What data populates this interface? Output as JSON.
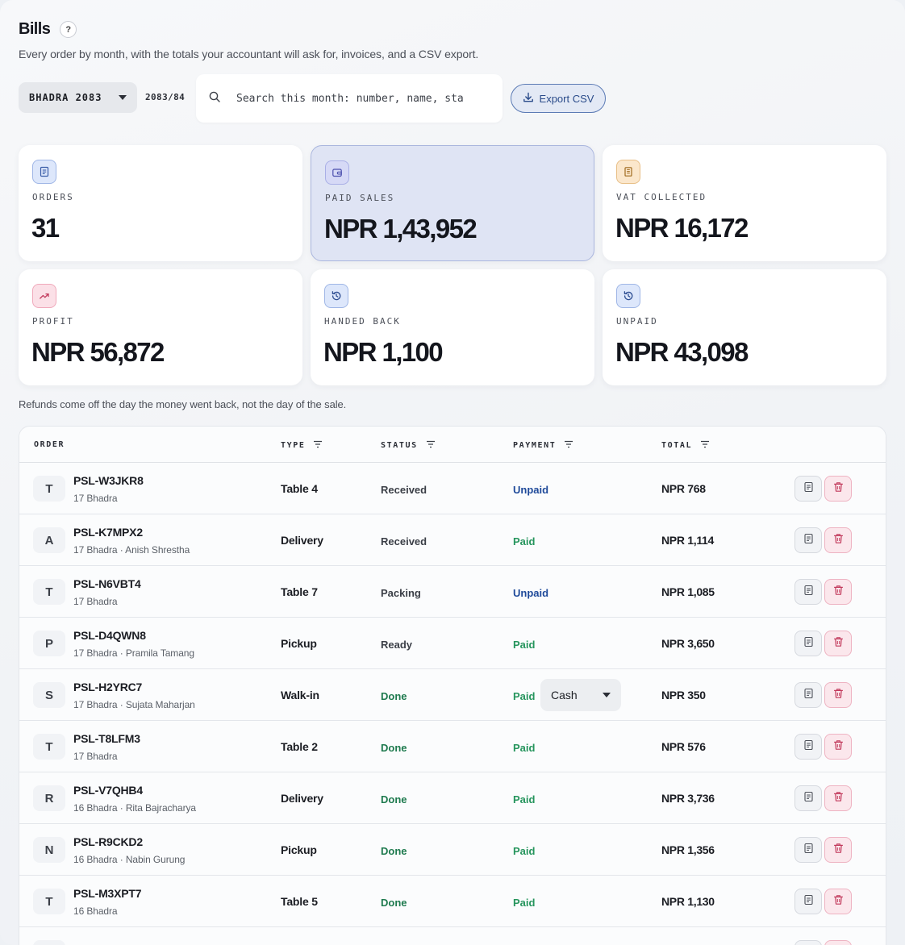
{
  "header": {
    "title": "Bills",
    "help_label": "?",
    "subtitle": "Every order by month, with the totals your accountant will ask for, invoices, and a CSV export."
  },
  "toolbar": {
    "month": "BHADRA 2083",
    "fiscal_year": "2083/84",
    "search_placeholder": "Search this month: number, name, sta",
    "export_label": "Export CSV"
  },
  "stats": [
    {
      "label": "ORDERS",
      "value": "31",
      "icon": "receipt-icon"
    },
    {
      "label": "PAID SALES",
      "value": "NPR 1,43,952",
      "icon": "wallet-icon"
    },
    {
      "label": "VAT COLLECTED",
      "value": "NPR 16,172",
      "icon": "building-icon"
    },
    {
      "label": "PROFIT",
      "value": "NPR 56,872",
      "icon": "trending-up-icon"
    },
    {
      "label": "HANDED BACK",
      "value": "NPR 1,100",
      "icon": "history-icon"
    },
    {
      "label": "UNPAID",
      "value": "NPR 43,098",
      "icon": "history-icon"
    }
  ],
  "note": "Refunds come off the day the money went back, not the day of the sale.",
  "table": {
    "columns": [
      "ORDER",
      "TYPE",
      "STATUS",
      "PAYMENT",
      "TOTAL"
    ],
    "rows": [
      {
        "initial": "T",
        "number": "PSL-W3JKR8",
        "meta": "17 Bhadra",
        "type": "Table 4",
        "status": "Received",
        "payment": "Unpaid",
        "total": "NPR 768"
      },
      {
        "initial": "A",
        "number": "PSL-K7MPX2",
        "meta": "17 Bhadra · Anish Shrestha",
        "type": "Delivery",
        "status": "Received",
        "payment": "Paid",
        "total": "NPR 1,114"
      },
      {
        "initial": "T",
        "number": "PSL-N6VBT4",
        "meta": "17 Bhadra",
        "type": "Table 7",
        "status": "Packing",
        "payment": "Unpaid",
        "total": "NPR 1,085"
      },
      {
        "initial": "P",
        "number": "PSL-D4QWN8",
        "meta": "17 Bhadra · Pramila Tamang",
        "type": "Pickup",
        "status": "Ready",
        "payment": "Paid",
        "total": "NPR 3,650"
      },
      {
        "initial": "S",
        "number": "PSL-H2YRC7",
        "meta": "17 Bhadra · Sujata Maharjan",
        "type": "Walk-in",
        "status": "Done",
        "payment": "Paid",
        "method": "Cash",
        "total": "NPR 350"
      },
      {
        "initial": "T",
        "number": "PSL-T8LFM3",
        "meta": "17 Bhadra",
        "type": "Table 2",
        "status": "Done",
        "payment": "Paid",
        "total": "NPR 576"
      },
      {
        "initial": "R",
        "number": "PSL-V7QHB4",
        "meta": "16 Bhadra · Rita Bajracharya",
        "type": "Delivery",
        "status": "Done",
        "payment": "Paid",
        "total": "NPR 3,736"
      },
      {
        "initial": "N",
        "number": "PSL-R9CKD2",
        "meta": "16 Bhadra · Nabin Gurung",
        "type": "Pickup",
        "status": "Done",
        "payment": "Paid",
        "total": "NPR 1,356"
      },
      {
        "initial": "T",
        "number": "PSL-M3XPT7",
        "meta": "16 Bhadra",
        "type": "Table 5",
        "status": "Done",
        "payment": "Paid",
        "total": "NPR 1,130"
      }
    ]
  }
}
